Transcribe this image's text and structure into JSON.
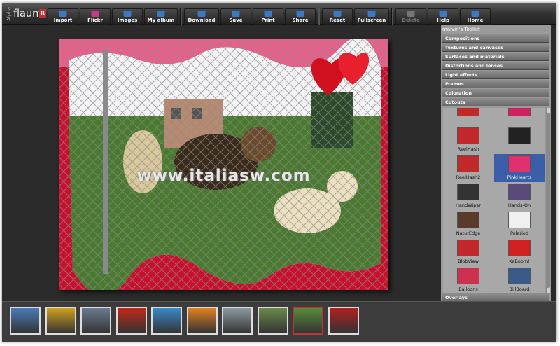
{
  "logo": {
    "alpha": "Alpha",
    "name": "flaunt",
    "mark": "R"
  },
  "toolbar": {
    "group1": [
      {
        "label": "Import",
        "icon": "import-icon",
        "color": "#3a78c8"
      },
      {
        "label": "Flickr",
        "icon": "flickr-icon",
        "color": "#c8388a"
      },
      {
        "label": "Images",
        "icon": "images-icon",
        "color": "#3a78c8"
      },
      {
        "label": "My album",
        "icon": "album-icon",
        "color": "#3a78c8"
      }
    ],
    "group2": [
      {
        "label": "Download",
        "icon": "download-icon",
        "color": "#3a78c8"
      },
      {
        "label": "Save",
        "icon": "save-icon",
        "color": "#3a78c8"
      },
      {
        "label": "Print",
        "icon": "print-icon",
        "color": "#3a78c8"
      },
      {
        "label": "Share",
        "icon": "share-icon",
        "color": "#3a78c8"
      }
    ],
    "group3": [
      {
        "label": "Reset",
        "icon": "reset-icon",
        "color": "#3a78c8"
      },
      {
        "label": "Fullscreen",
        "icon": "fullscreen-icon",
        "color": "#3a78c8"
      }
    ],
    "group4": [
      {
        "label": "Delete",
        "icon": "delete-icon",
        "color": "#777777",
        "disabled": true
      },
      {
        "label": "Help",
        "icon": "help-icon",
        "color": "#3a78c8"
      },
      {
        "label": "Home",
        "icon": "home-icon",
        "color": "#3a78c8"
      }
    ]
  },
  "canvas": {
    "watermark": "www.italiasw.com"
  },
  "panel": {
    "title": "malvin's Toolkit",
    "categories": [
      "Compositions",
      "Textures and canvases",
      "Surfaces and materials",
      "Distortions and lenses",
      "Light effects",
      "Frames",
      "Coloration",
      "Cutouts"
    ],
    "footer_category": "Overlays",
    "cutouts": [
      {
        "label": "",
        "color": "#c0282a"
      },
      {
        "label": "",
        "color": "#d02060"
      },
      {
        "label": "ReelHash",
        "color": "#c0282a"
      },
      {
        "label": "",
        "color": "#222222"
      },
      {
        "label": "ReelHash2",
        "color": "#c0282a"
      },
      {
        "label": "PinkHearts",
        "color": "#e03070",
        "selected": true
      },
      {
        "label": "HandWiper",
        "color": "#333333"
      },
      {
        "label": "Hands-On",
        "color": "#5a4a7a"
      },
      {
        "label": "NaturEdge",
        "color": "#5a3a2a"
      },
      {
        "label": "Polariod",
        "color": "#f0f0f0"
      },
      {
        "label": "BlobView",
        "color": "#c0282a"
      },
      {
        "label": "KaBoom!",
        "color": "#d02020"
      },
      {
        "label": "Balloons",
        "color": "#d03050"
      },
      {
        "label": "BillBoard",
        "color": "#3a5a8a"
      },
      {
        "label": "",
        "color": "#f0f0f0"
      },
      {
        "label": "",
        "color": "#3a6ab0"
      }
    ]
  },
  "strip": {
    "thumbs": [
      {
        "name": "thumb-beach-road",
        "color": "#4a7ab8"
      },
      {
        "name": "thumb-sunflower",
        "color": "#d0a020"
      },
      {
        "name": "thumb-market",
        "color": "#6a7a90"
      },
      {
        "name": "thumb-chili-peppers",
        "color": "#c02818"
      },
      {
        "name": "thumb-palm-beach",
        "color": "#3a88c8"
      },
      {
        "name": "thumb-bird-of-paradise",
        "color": "#e08020"
      },
      {
        "name": "thumb-duck",
        "color": "#8a9aa0"
      },
      {
        "name": "thumb-road",
        "color": "#6a8a4a"
      },
      {
        "name": "thumb-dogs",
        "color": "#5a8a3a",
        "selected": true
      },
      {
        "name": "thumb-red-wheel",
        "color": "#b02020"
      }
    ]
  }
}
